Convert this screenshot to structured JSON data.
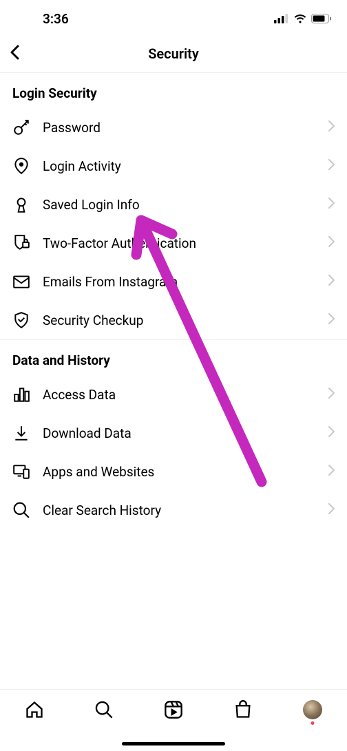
{
  "status": {
    "time": "3:36"
  },
  "header": {
    "title": "Security"
  },
  "sections": {
    "login_security": {
      "title": "Login Security",
      "items": [
        {
          "label": "Password"
        },
        {
          "label": "Login Activity"
        },
        {
          "label": "Saved Login Info"
        },
        {
          "label": "Two-Factor Authentication"
        },
        {
          "label": "Emails From Instagram"
        },
        {
          "label": "Security Checkup"
        }
      ]
    },
    "data_history": {
      "title": "Data and History",
      "items": [
        {
          "label": "Access Data"
        },
        {
          "label": "Download Data"
        },
        {
          "label": "Apps and Websites"
        },
        {
          "label": "Clear Search History"
        }
      ]
    }
  }
}
